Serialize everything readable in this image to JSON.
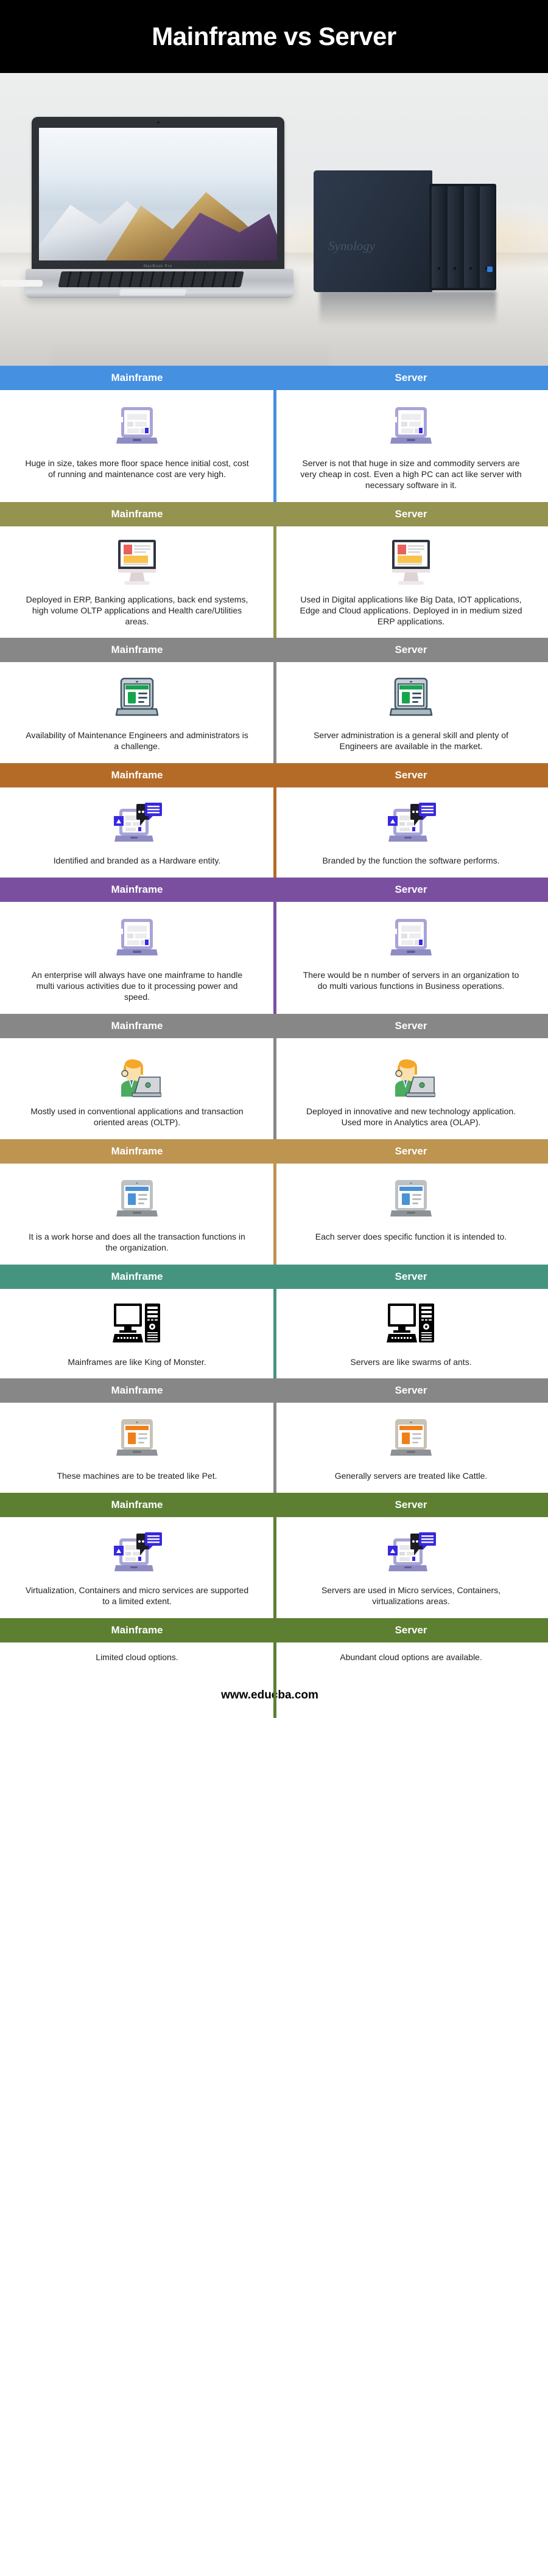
{
  "title": "Mainframe vs Server",
  "hero": {
    "laptop_label": "MacBook Pro",
    "nas_brand": "Synology"
  },
  "column_headers": {
    "left": "Mainframe",
    "right": "Server"
  },
  "footer": {
    "url": "www.educba.com"
  },
  "rows": [
    {
      "band_color": "#4590e0",
      "icon": "laptop-wireframe-icon",
      "left": "Huge in size, takes more floor space hence initial cost, cost of running and maintenance cost are very high.",
      "right": "Server is not that huge in size and commodity servers are very cheap in cost. Even a high PC can act like server with necessary software in it."
    },
    {
      "band_color": "#949350",
      "icon": "desktop-monitor-icon",
      "left": "Deployed in ERP, Banking applications, back end systems, high volume OLTP applications and Health care/Utilities areas.",
      "right": "Used in Digital applications like Big Data, IOT applications, Edge and Cloud applications. Deployed in in medium sized ERP applications."
    },
    {
      "band_color": "#878787",
      "icon": "laptop-green-dashboard-icon",
      "left": "Availability of Maintenance Engineers and administrators is a challenge.",
      "right": "Server administration is a general skill and plenty of Engineers are available in the market."
    },
    {
      "band_color": "#b56b28",
      "icon": "laptop-chat-bubble-icon",
      "left": "Identified and branded as a Hardware entity.",
      "right": "Branded by the function the software performs."
    },
    {
      "band_color": "#7b4fa0",
      "icon": "laptop-wireframe-icon",
      "left": "An enterprise will always have one mainframe to handle multi various activities due to it processing power and speed.",
      "right": "There would be n number of servers in an organization to do multi various functions in Business operations."
    },
    {
      "band_color": "#878787",
      "icon": "person-at-laptop-icon",
      "left": "Mostly used in conventional applications and transaction oriented areas (OLTP).",
      "right": "Deployed in innovative and new technology application. Used more in Analytics area (OLAP)."
    },
    {
      "band_color": "#bd9450",
      "icon": "laptop-blue-dashboard-icon",
      "left": "It is a work horse and does all the transaction functions in the organization.",
      "right": "Each server does specific function it is intended to."
    },
    {
      "band_color": "#459480",
      "icon": "desktop-tower-icon",
      "left": "Mainframes are like King of Monster.",
      "right": "Servers are like swarms of ants."
    },
    {
      "band_color": "#878787",
      "icon": "laptop-orange-dashboard-icon",
      "left": "These machines are to be treated like Pet.",
      "right": "Generally servers are treated like Cattle."
    },
    {
      "band_color": "#5c7f32",
      "icon": "laptop-chat-bubble-icon",
      "left": "Virtualization, Containers and micro services are supported to a limited extent.",
      "right": "Servers are used in Micro services, Containers, virtualizations areas."
    },
    {
      "band_color": "#5c7f32",
      "icon": "none",
      "left": "Limited cloud options.",
      "right": "Abundant cloud options are available."
    }
  ]
}
